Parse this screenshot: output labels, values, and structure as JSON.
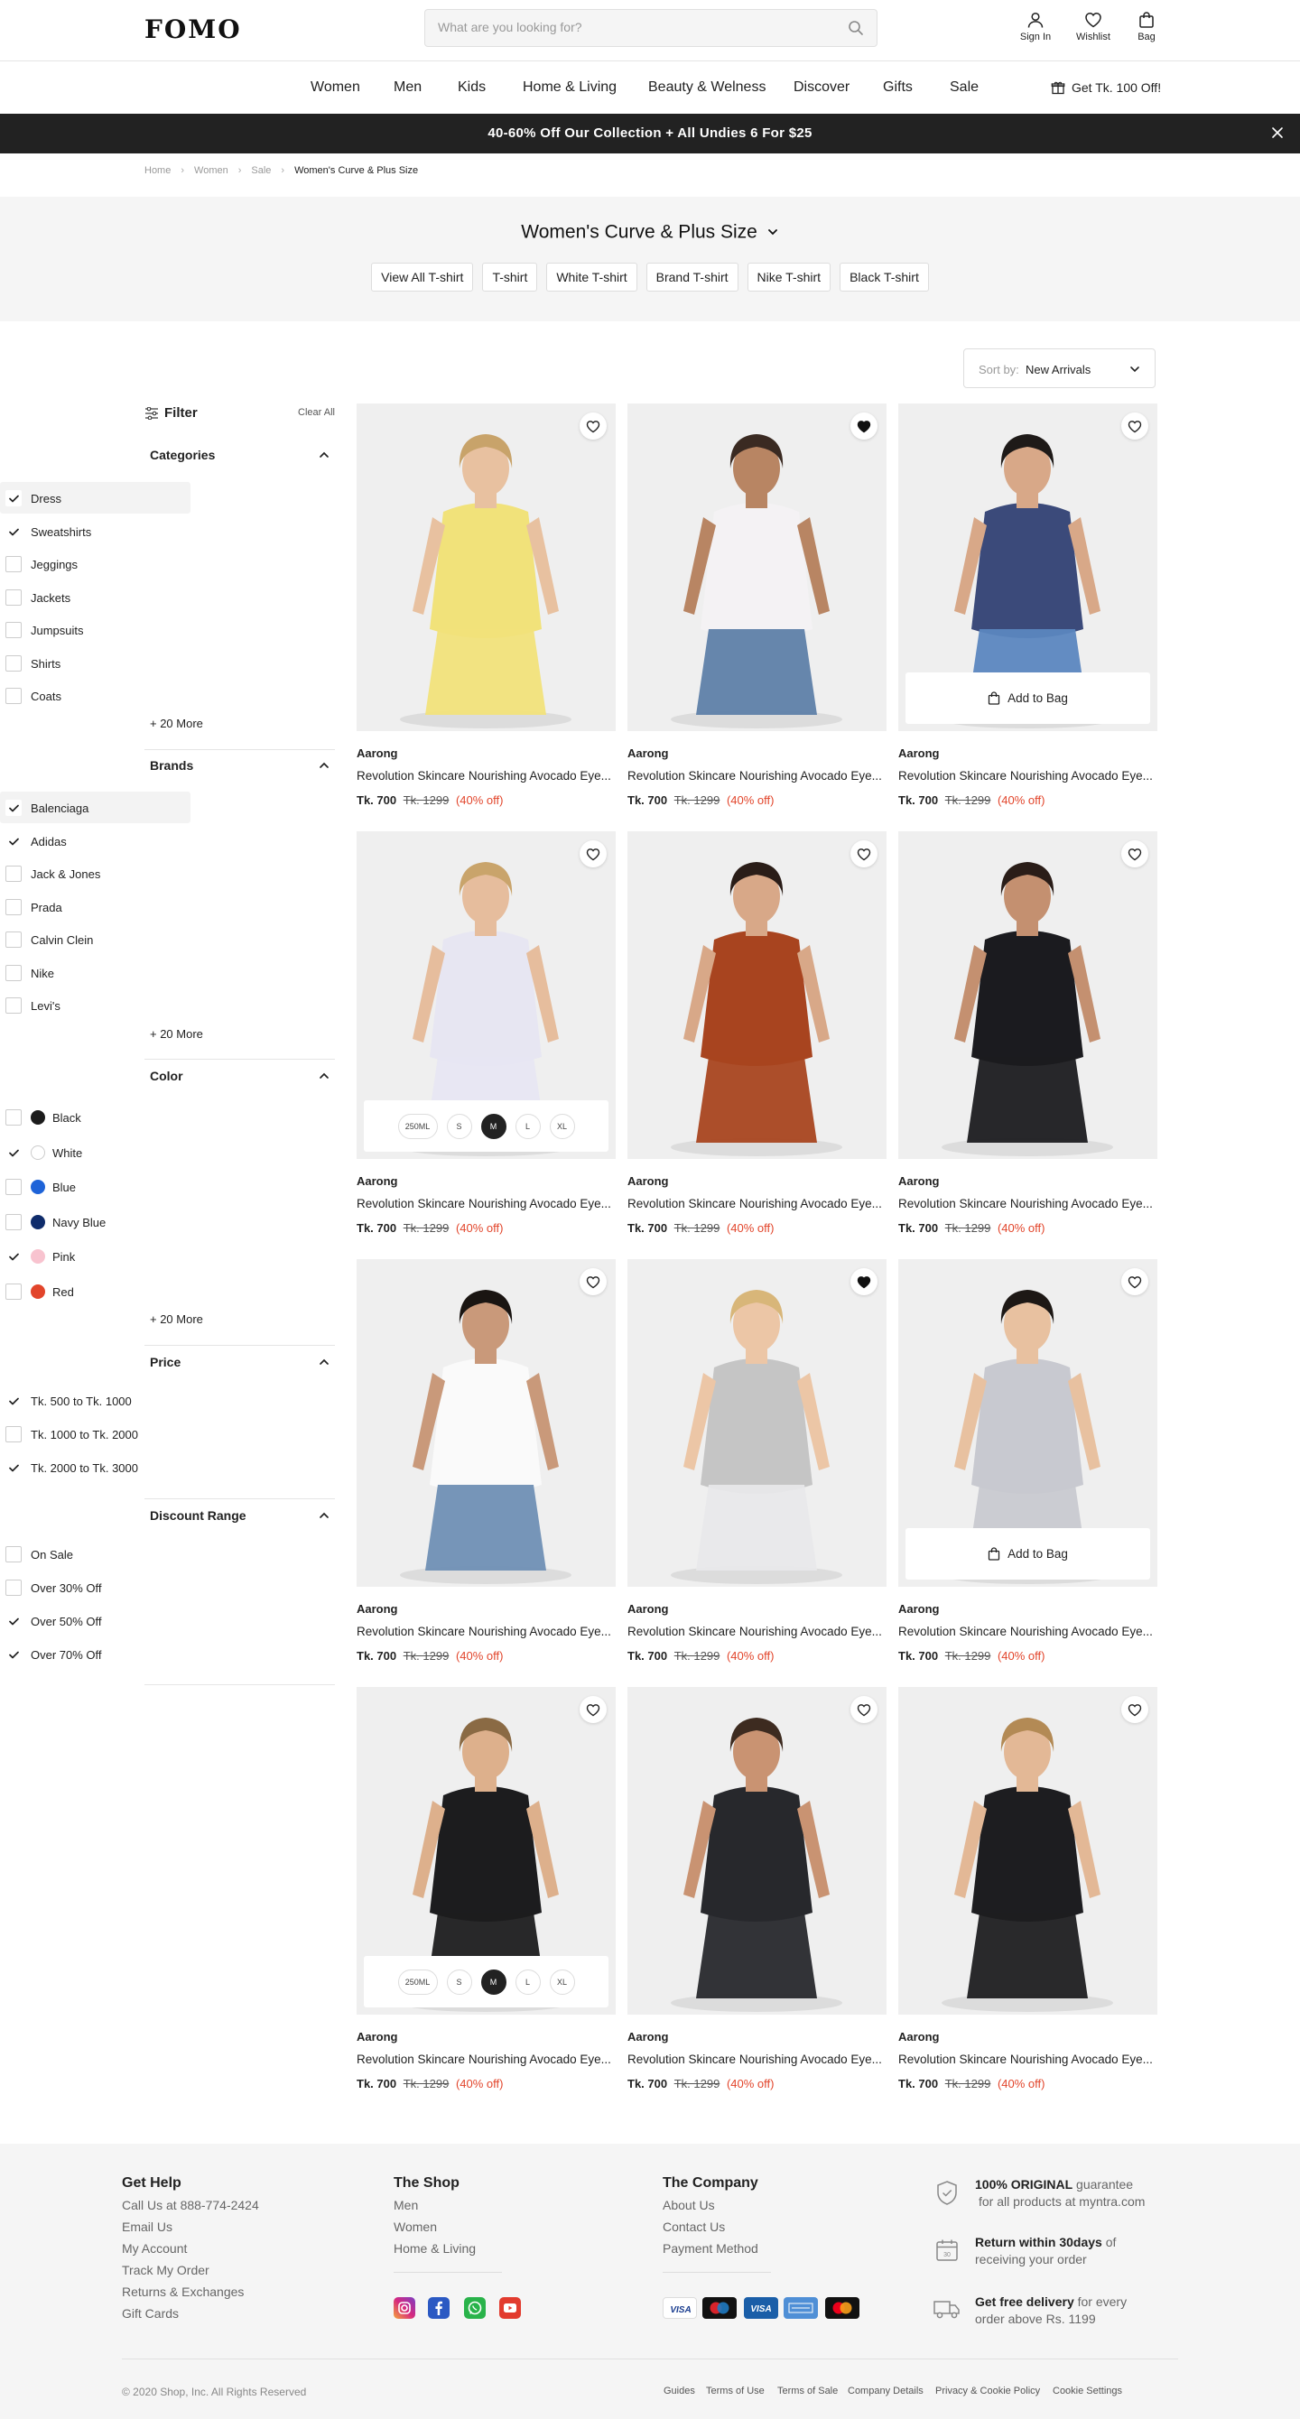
{
  "brand": {
    "logo": "FOMO"
  },
  "header": {
    "search_placeholder": "What are you looking for?",
    "sign_in": "Sign In",
    "wishlist": "Wishlist",
    "bag": "Bag"
  },
  "nav": {
    "items": [
      "Women",
      "Men",
      "Kids",
      "Home & Living",
      "Beauty & Welness",
      "Discover",
      "Gifts",
      "Sale"
    ],
    "offer": "Get Tk. 100 Off!"
  },
  "promo": {
    "text": "40-60% Off Our Collection + All Undies 6 For $25"
  },
  "breadcrumb": [
    "Home",
    "Women",
    "Sale",
    "Women's Curve & Plus Size"
  ],
  "category": {
    "title": "Women's Curve & Plus Size",
    "pills": [
      "View All T-shirt",
      "T-shirt",
      "White T-shirt",
      "Brand T-shirt",
      "Nike T-shirt",
      "Black T-shirt"
    ]
  },
  "sort": {
    "label": "Sort by:",
    "value": "New Arrivals"
  },
  "filter": {
    "title": "Filter",
    "clear": "Clear All",
    "categories": {
      "title": "Categories",
      "options": [
        {
          "label": "Dress",
          "checked": true
        },
        {
          "label": "Sweatshirts",
          "checked": true
        },
        {
          "label": "Jeggings",
          "checked": false
        },
        {
          "label": "Jackets",
          "checked": false
        },
        {
          "label": "Jumpsuits",
          "checked": false
        },
        {
          "label": "Shirts",
          "checked": false
        },
        {
          "label": "Coats",
          "checked": false
        }
      ],
      "more": "+ 20 More"
    },
    "brands": {
      "title": "Brands",
      "options": [
        {
          "label": "Balenciaga",
          "checked": true
        },
        {
          "label": "Adidas",
          "checked": true
        },
        {
          "label": "Jack & Jones",
          "checked": false
        },
        {
          "label": "Prada",
          "checked": false
        },
        {
          "label": "Calvin Clein",
          "checked": false
        },
        {
          "label": "Nike",
          "checked": false
        },
        {
          "label": "Levi's",
          "checked": false
        }
      ],
      "more": "+ 20 More"
    },
    "color": {
      "title": "Color",
      "options": [
        {
          "label": "Black",
          "checked": false,
          "swatch": "#1c1c1c"
        },
        {
          "label": "White",
          "checked": true,
          "swatch": "#ffffff"
        },
        {
          "label": "Blue",
          "checked": false,
          "swatch": "#1e63d8"
        },
        {
          "label": "Navy Blue",
          "checked": false,
          "swatch": "#0f2c6b"
        },
        {
          "label": "Pink",
          "checked": true,
          "swatch": "#f8c3cf"
        },
        {
          "label": "Red",
          "checked": false,
          "swatch": "#e2452b"
        }
      ],
      "more": "+ 20 More"
    },
    "price": {
      "title": "Price",
      "options": [
        {
          "label": "Tk. 500 to Tk. 1000",
          "checked": true
        },
        {
          "label": "Tk. 1000 to Tk. 2000",
          "checked": false
        },
        {
          "label": "Tk. 2000 to Tk. 3000",
          "checked": true
        }
      ]
    },
    "discount": {
      "title": "Discount Range",
      "options": [
        {
          "label": "On Sale",
          "checked": false
        },
        {
          "label": "Over 30% Off",
          "checked": false
        },
        {
          "label": "Over 50% Off",
          "checked": true
        },
        {
          "label": "Over 70% Off",
          "checked": true
        }
      ]
    }
  },
  "product_common": {
    "add_to_bag": "Add to Bag",
    "sizes": [
      "250ML",
      "S",
      "M",
      "L",
      "XL"
    ],
    "selected_size": "M"
  },
  "products": [
    {
      "brand": "Aarong",
      "name": "Revolution Skincare Nourishing Avocado Eye...",
      "price": "Tk. 700",
      "old_price": "Tk. 1299",
      "discount": "(40% off)",
      "wishlisted": false,
      "overlay": "",
      "garment": "#f1e27a",
      "skin": "#e8c1a0",
      "hair": "#c8a36a",
      "bottom": "#f1e27a"
    },
    {
      "brand": "Aarong",
      "name": "Revolution Skincare Nourishing Avocado Eye...",
      "price": "Tk. 700",
      "old_price": "Tk. 1299",
      "discount": "(40% off)",
      "wishlisted": true,
      "overlay": "",
      "garment": "#f4f2f4",
      "skin": "#b88563",
      "hair": "#3a2a22",
      "bottom": "#5e7fa8"
    },
    {
      "brand": "Aarong",
      "name": "Revolution Skincare Nourishing Avocado Eye...",
      "price": "Tk. 700",
      "old_price": "Tk. 1299",
      "discount": "(40% off)",
      "wishlisted": false,
      "overlay": "bag",
      "garment": "#3b4a7a",
      "skin": "#d8a888",
      "hair": "#1e1a18",
      "bottom": "#5b86bf"
    },
    {
      "brand": "Aarong",
      "name": "Revolution Skincare Nourishing Avocado Eye...",
      "price": "Tk. 700",
      "old_price": "Tk. 1299",
      "discount": "(40% off)",
      "wishlisted": false,
      "overlay": "sizes",
      "garment": "#e7e6f2",
      "skin": "#e6bd9d",
      "hair": "#c9a46b",
      "bottom": "#e7e6f2"
    },
    {
      "brand": "Aarong",
      "name": "Revolution Skincare Nourishing Avocado Eye...",
      "price": "Tk. 700",
      "old_price": "Tk. 1299",
      "discount": "(40% off)",
      "wishlisted": false,
      "overlay": "",
      "garment": "#a8441f",
      "skin": "#d8a888",
      "hair": "#2a1d18",
      "bottom": "#a8441f"
    },
    {
      "brand": "Aarong",
      "name": "Revolution Skincare Nourishing Avocado Eye...",
      "price": "Tk. 700",
      "old_price": "Tk. 1299",
      "discount": "(40% off)",
      "wishlisted": false,
      "overlay": "",
      "garment": "#1b1b1f",
      "skin": "#c49070",
      "hair": "#2a1d18",
      "bottom": "#1b1b1f"
    },
    {
      "brand": "Aarong",
      "name": "Revolution Skincare Nourishing Avocado Eye...",
      "price": "Tk. 700",
      "old_price": "Tk. 1299",
      "discount": "(40% off)",
      "wishlisted": false,
      "overlay": "",
      "garment": "#fafafa",
      "skin": "#c9997a",
      "hair": "#1a1512",
      "bottom": "#6f8fb4"
    },
    {
      "brand": "Aarong",
      "name": "Revolution Skincare Nourishing Avocado Eye...",
      "price": "Tk. 700",
      "old_price": "Tk. 1299",
      "discount": "(40% off)",
      "wishlisted": true,
      "overlay": "",
      "garment": "#c5c5c5",
      "skin": "#ecc6a6",
      "hair": "#d8b679",
      "bottom": "#e8e8ea"
    },
    {
      "brand": "Aarong",
      "name": "Revolution Skincare Nourishing Avocado Eye...",
      "price": "Tk. 700",
      "old_price": "Tk. 1299",
      "discount": "(40% off)",
      "wishlisted": false,
      "overlay": "bag",
      "garment": "#c8c9d0",
      "skin": "#e8c1a0",
      "hair": "#1d1815",
      "bottom": "#c8c9d0"
    },
    {
      "brand": "Aarong",
      "name": "Revolution Skincare Nourishing Avocado Eye...",
      "price": "Tk. 700",
      "old_price": "Tk. 1299",
      "discount": "(40% off)",
      "wishlisted": false,
      "overlay": "sizes",
      "garment": "#1c1c1e",
      "skin": "#ddb08c",
      "hair": "#8a6a44",
      "bottom": "#1c1c1e"
    },
    {
      "brand": "Aarong",
      "name": "Revolution Skincare Nourishing Avocado Eye...",
      "price": "Tk. 700",
      "old_price": "Tk. 1299",
      "discount": "(40% off)",
      "wishlisted": false,
      "overlay": "",
      "garment": "#27282c",
      "skin": "#c99372",
      "hair": "#3d2b20",
      "bottom": "#27282c"
    },
    {
      "brand": "Aarong",
      "name": "Revolution Skincare Nourishing Avocado Eye...",
      "price": "Tk. 700",
      "old_price": "Tk. 1299",
      "discount": "(40% off)",
      "wishlisted": false,
      "overlay": "",
      "garment": "#1d1d20",
      "skin": "#e3b896",
      "hair": "#b38a55",
      "bottom": "#1d1d20"
    }
  ],
  "footer": {
    "help": {
      "title": "Get Help",
      "links": [
        "Call Us at 888-774-2424",
        "Email Us",
        "My Account",
        "Track My Order",
        "Returns & Exchanges",
        "Gift Cards"
      ]
    },
    "shop": {
      "title": "The Shop",
      "links": [
        "Men",
        "Women",
        "Home & Living"
      ]
    },
    "company": {
      "title": "The Company",
      "links": [
        "About Us",
        "Contact Us",
        "Payment Method"
      ]
    },
    "assurances": [
      {
        "bold": "100% ORIGINAL",
        "text1": " guarantee",
        "text2": "for all products at myntra.com"
      },
      {
        "bold": "Return within 30days",
        "text1": " of",
        "text2": "receiving your order"
      },
      {
        "bold": "Get free delivery",
        "text1": " for every",
        "text2": "order above Rs. 1199"
      }
    ],
    "social_icons": [
      "instagram-icon",
      "facebook-icon",
      "whatsapp-icon",
      "youtube-icon"
    ],
    "payment_icons": [
      "visa-icon",
      "maestro-icon",
      "visa-blue-icon",
      "amex-icon",
      "mastercard-icon"
    ],
    "copyright": "© 2020 Shop, Inc. All Rights Reserved",
    "legal": [
      "Guides",
      "Terms of Use",
      "Terms of Sale",
      "Company Details",
      "Privacy & Cookie Policy",
      "Cookie Settings"
    ]
  },
  "colors": {
    "accent": "#e2452b",
    "dark": "#222222",
    "band": "#f5f5f5"
  }
}
